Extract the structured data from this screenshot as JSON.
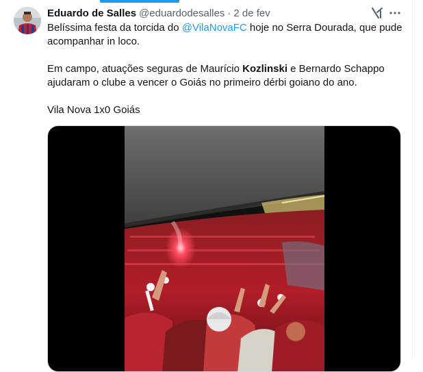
{
  "tweet": {
    "display_name": "Eduardo de Salles",
    "handle": "@eduardodesalles",
    "separator": "·",
    "date": "2 de fev",
    "paragraph1": {
      "before_mention": "Belíssima festa da torcida do ",
      "mention": "@VilaNovaFC",
      "after_mention": " hoje no Serra Dourada, que pude acompanhar in loco."
    },
    "paragraph2": {
      "before_bold": "Em campo, atuações seguras de Maurício ",
      "bold": "Kozlinski",
      "after_bold": " e Bernardo Schappo ajudaram o clube a vencer o Goiás no primeiro dérbi goiano do ano."
    },
    "paragraph3": "Vila Nova 1x0 Goiás"
  },
  "icons": {
    "grok": "grok-icon",
    "more": "more-icon"
  },
  "colors": {
    "accent": "#1d9bf0",
    "text": "#0f1419",
    "secondary": "#536471",
    "crowd_red": "#c0182a",
    "flare": "#ff4a5e"
  }
}
